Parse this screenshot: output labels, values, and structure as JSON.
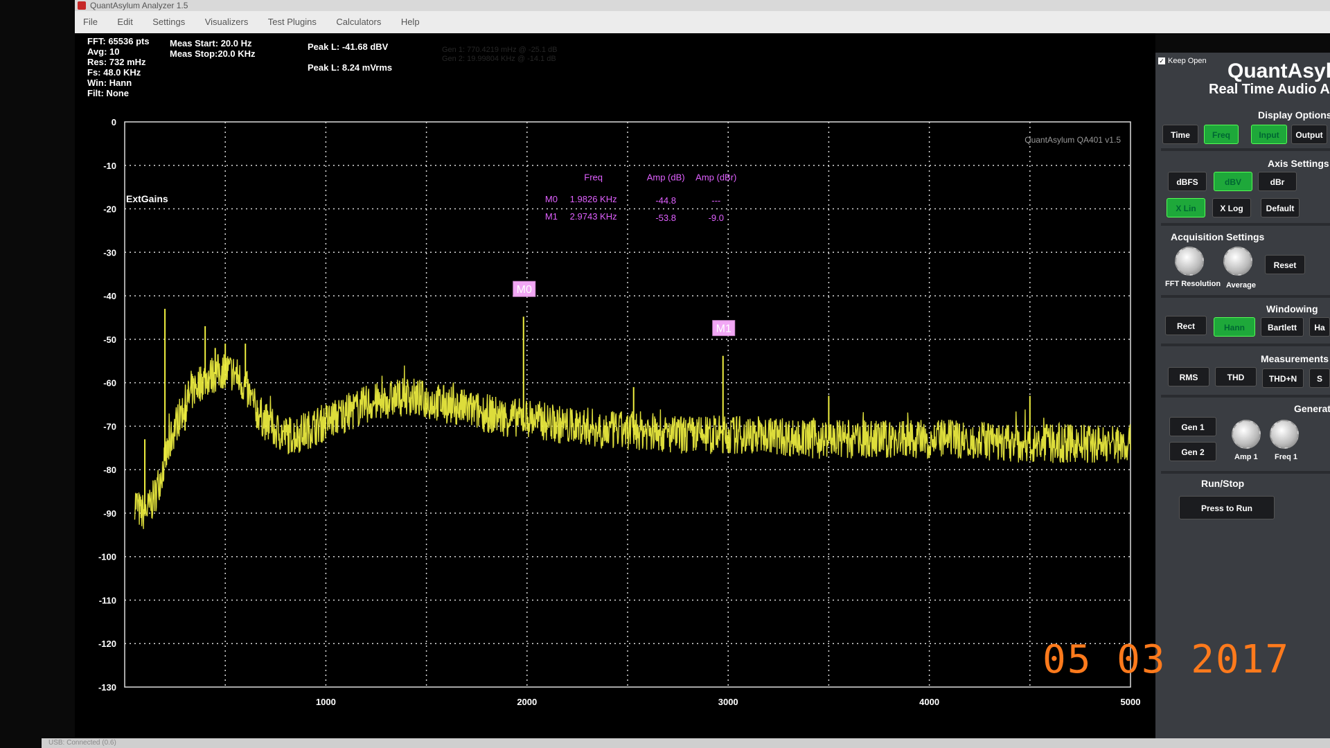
{
  "window": {
    "title": "QuantAsylum Analyzer 1.5"
  },
  "menu": [
    "File",
    "Edit",
    "Settings",
    "Visualizers",
    "Test Plugins",
    "Calculators",
    "Help"
  ],
  "info": {
    "fft": "FFT: 65536 pts",
    "avg": "Avg: 10",
    "res": "Res: 732 mHz",
    "fs": "Fs: 48.0 KHz",
    "win": "Win: Hann",
    "filt": "Filt: None",
    "meas_start": "Meas Start: 20.0 Hz",
    "meas_stop": "Meas Stop:20.0 KHz",
    "peak_dbv": "Peak L: -41.68 dBV",
    "peak_mvrms": "Peak L: 8.24 mVrms",
    "gen1": "Gen 1: 770.4219 mHz @ -25.1 dB",
    "gen2": "Gen 2: 19.99804 KHz @ -14.1 dB"
  },
  "plot": {
    "watermark": "QuantAsylum QA401 v1.5",
    "ext_gains": "ExtGains",
    "ylabel": "dBV",
    "marker_table": {
      "headers": [
        "Freq",
        "Amp (dB)",
        "Amp (dBr)"
      ],
      "rows": [
        {
          "name": "M0",
          "freq": "1.9826 KHz",
          "amp": "-44.8",
          "ampr": "---"
        },
        {
          "name": "M1",
          "freq": "2.9743 KHz",
          "amp": "-53.8",
          "ampr": "-9.0"
        }
      ]
    },
    "markers": [
      {
        "label": "M0",
        "freq": 1982.6,
        "amp": -44.8
      },
      {
        "label": "M1",
        "freq": 2974.3,
        "amp": -53.8
      }
    ]
  },
  "chart_data": {
    "type": "line",
    "title": "",
    "xlabel": "",
    "ylabel": "dBV",
    "xlim": [
      0,
      5000
    ],
    "ylim": [
      -130,
      0
    ],
    "x_ticks": [
      1000,
      2000,
      3000,
      4000,
      5000
    ],
    "y_ticks": [
      0,
      -10,
      -20,
      -30,
      -40,
      -50,
      -60,
      -70,
      -80,
      -90,
      -100,
      -110,
      -120,
      -130
    ],
    "grid": true,
    "series": [
      {
        "color": "#f0f040",
        "x": [
          50,
          80,
          120,
          150,
          200,
          250,
          300,
          350,
          400,
          450,
          500,
          550,
          600,
          650,
          700,
          750,
          800,
          850,
          900,
          950,
          1000,
          1100,
          1200,
          1300,
          1400,
          1500,
          1600,
          1700,
          1800,
          1900,
          2000,
          2100,
          2200,
          2300,
          2400,
          2500,
          2600,
          2700,
          2800,
          2900,
          3000,
          3200,
          3400,
          3600,
          3800,
          4000,
          4200,
          4400,
          4600,
          4800,
          5000
        ],
        "y": [
          -87,
          -90,
          -89,
          -86,
          -78,
          -70,
          -65,
          -61,
          -59,
          -58,
          -57,
          -58,
          -61,
          -66,
          -69,
          -71,
          -72,
          -72,
          -71,
          -70,
          -69,
          -67,
          -65,
          -64,
          -63,
          -64,
          -65,
          -66,
          -67,
          -68,
          -68,
          -69,
          -70,
          -70,
          -71,
          -71,
          -71,
          -72,
          -72,
          -72,
          -72,
          -72,
          -73,
          -73,
          -73,
          -73,
          -73,
          -74,
          -74,
          -74,
          -74
        ]
      }
    ],
    "spurs": [
      {
        "x": 100,
        "y": -73
      },
      {
        "x": 200,
        "y": -43
      },
      {
        "x": 300,
        "y": -71
      },
      {
        "x": 400,
        "y": -47
      },
      {
        "x": 450,
        "y": -52
      },
      {
        "x": 500,
        "y": -51
      },
      {
        "x": 600,
        "y": -51
      },
      {
        "x": 1982.6,
        "y": -44.8
      },
      {
        "x": 2530,
        "y": -61
      },
      {
        "x": 2974.3,
        "y": -53.8
      },
      {
        "x": 3500,
        "y": -63
      },
      {
        "x": 4500,
        "y": -63
      }
    ]
  },
  "panel": {
    "keep_open": "Keep Open",
    "brand": "QuantAsyl",
    "subtitle": "Real Time Audio A",
    "display_options": "Display Options",
    "display_buttons": [
      "Time",
      "Freq",
      "Input",
      "Output"
    ],
    "axis_settings": "Axis Settings",
    "axis_buttons": [
      "dBFS",
      "dBV",
      "dBr",
      "X Lin",
      "X Log",
      "Default"
    ],
    "acq_settings": "Acquisition Settings",
    "acq_labels": [
      "FFT Resolution",
      "Average"
    ],
    "reset": "Reset",
    "windowing": "Windowing",
    "window_buttons": [
      "Rect",
      "Hann",
      "Bartlett",
      "Ha"
    ],
    "measurements": "Measurements",
    "meas_buttons": [
      "RMS",
      "THD",
      "THD+N",
      "S"
    ],
    "generator": "Generat",
    "gen_buttons": [
      "Gen 1",
      "Gen 2"
    ],
    "gen_knobs": [
      "Amp 1",
      "Freq 1"
    ],
    "run_stop": "Run/Stop",
    "run_button": "Press to Run"
  },
  "status": "USB: Connected (0.6)",
  "datestamp": "05 03 2017"
}
